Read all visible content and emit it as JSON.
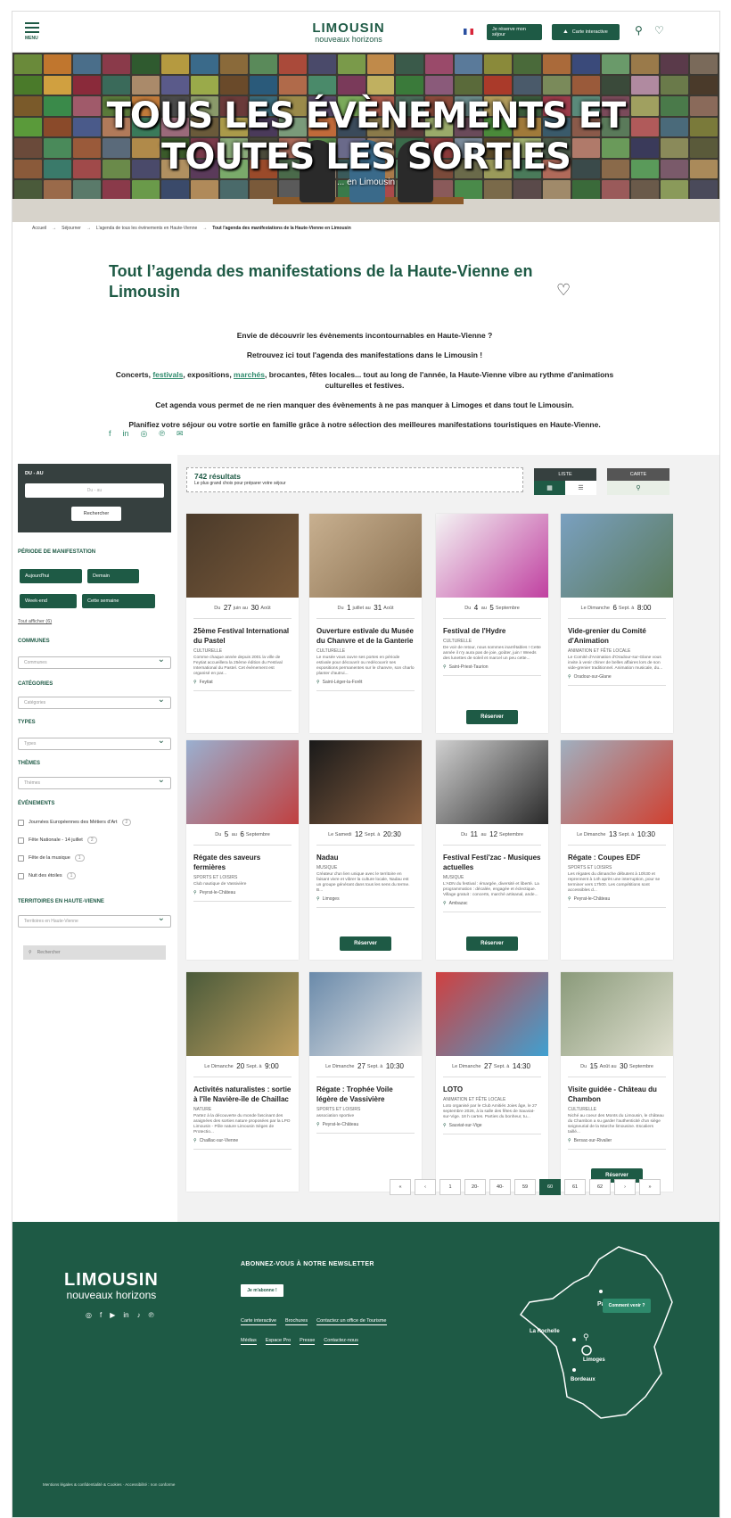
{
  "header": {
    "menu_label": "MENU",
    "logo_top": "LIMOUSIN",
    "logo_bottom": "nouveaux horizons",
    "reserve_label": "Je réserve mon séjour",
    "map_label": "Carte interactive"
  },
  "hero": {
    "title": "TOUS LES ÉVÈNEMENTS ET TOUTES LES SORTIES",
    "subtitle": "... en Limousin"
  },
  "breadcrumb": [
    "Accueil",
    "Séjourner",
    "L'agenda de tous les événements en Haute-Vienne",
    "Tout l'agenda des manifestations de la Haute-Vienne en Limousin"
  ],
  "page": {
    "title": "Tout l’agenda des manifestations de la Haute-Vienne en Limousin",
    "p1": "Envie de découvrir les évènements incontournables en Haute-Vienne ?",
    "p2": "Retrouvez ici tout l'agenda des manifestations dans le Limousin !",
    "p3_a": "Concerts, ",
    "p3_link1": "festivals",
    "p3_b": ", expositions, ",
    "p3_link2": "marchés",
    "p3_c": ", brocantes, fêtes locales... tout au long de l'année, la Haute-Vienne vibre au rythme d'animations culturelles et festives.",
    "p4": "Cet agenda vous permet de ne rien manquer des évènements à ne pas manquer à Limoges et dans tout le Limousin.",
    "p5": "Planifiez votre séjour ou votre sortie en famille grâce à notre sélection des meilleures manifestations touristiques en Haute-Vienne."
  },
  "sidebar": {
    "date_label": "DU - AU",
    "date_placeholder": "Du - au",
    "search_btn": "Rechercher",
    "period_title": "PÉRIODE DE MANIFESTATION",
    "periods": [
      "Aujourd'hui",
      "Demain",
      "Week-end",
      "Cette semaine"
    ],
    "show_all": "Tout afficher (6)",
    "communes_title": "COMMUNES",
    "communes_ph": "Communes",
    "categories_title": "CATÉGORIES",
    "categories_ph": "Catégories",
    "types_title": "TYPES",
    "types_ph": "Types",
    "themes_title": "THÈMES",
    "themes_ph": "Thèmes",
    "events_title": "ÉVÉNEMENTS",
    "events": [
      {
        "label": "Journées Européennes des Métiers d'Art",
        "count": "2"
      },
      {
        "label": "Fête Nationale - 14 juillet",
        "count": "2"
      },
      {
        "label": "Fête de la musique",
        "count": "1"
      },
      {
        "label": "Nuit des étoiles",
        "count": "1"
      }
    ],
    "terr_title": "TERRITOIRES EN HAUTE-VIENNE",
    "terr_ph": "Territoires en Haute-Vienne",
    "kw_ph": "Rechercher"
  },
  "results": {
    "count": "742 résultats",
    "sub": "Le plus grand choix pour préparer votre séjour",
    "list": "LISTE",
    "map": "CARTE"
  },
  "cards": [
    {
      "date_pre": "Du",
      "d1": "27",
      "m1": "juin",
      "mid": "au",
      "d2": "30",
      "m2": "Août",
      "title": "25ème Festival International du Pastel",
      "cat": "CULTURELLE",
      "desc": "Comme chaque année depuis 2001 la ville de Feytiat accueillera la 25ème édition du Festival International du Pastel. Cet évènement est organisé en par...",
      "loc": "Feytiat",
      "btn": ""
    },
    {
      "date_pre": "Du",
      "d1": "1",
      "m1": "juillet",
      "mid": "au",
      "d2": "31",
      "m2": "Août",
      "title": "Ouverture estivale du Musée du Chanvre et de la Ganterie",
      "cat": "CULTURELLE",
      "desc": "Le musée vous ouvre ses portes en période estivale pour découvrir ou redécouvrir ses expositions permanentes sur le chanvre, son charlo planter d'autrui...",
      "loc": "Saint-Léger-la-Forêt",
      "btn": ""
    },
    {
      "date_pre": "Du",
      "d1": "4",
      "m1": "",
      "mid": "au",
      "d2": "5",
      "m2": "Septembre",
      "title": "Festival de l'Hydre",
      "cat": "CULTURELLE",
      "desc": "De voir de retour, nous sommes inarrêtables ! Cette année il n'y aura pas de joie, goûter, juin ! Weeds des lunettes de soleil et marcel un peu cette...",
      "loc": "Saint-Priest-Taurion",
      "btn": "Réserver"
    },
    {
      "date_pre": "Le Dimanche",
      "d1": "6",
      "m1": "Sept.",
      "mid": "à",
      "d2": "8:00",
      "m2": "",
      "title": "Vide-grenier du Comité d'Animation",
      "cat": "ANIMATION ET FÊTE LOCALE",
      "desc": "Le Comité d'Animation d'Oradour-sur-Glane vous invite à venir chiner de belles affaires lors de son vide-grenier traditionnel. Animation musicale, du...",
      "loc": "Oradour-sur-Glane",
      "btn": ""
    },
    {
      "date_pre": "Du",
      "d1": "5",
      "m1": "",
      "mid": "au",
      "d2": "6",
      "m2": "Septembre",
      "title": "Régate des saveurs fermières",
      "cat": "SPORTS ET LOISIRS",
      "desc": "Club nautique de Vassivière",
      "loc": "Peyrat-le-Château",
      "btn": ""
    },
    {
      "date_pre": "Le Samedi",
      "d1": "12",
      "m1": "Sept.",
      "mid": "à",
      "d2": "20:30",
      "m2": "",
      "title": "Nadau",
      "cat": "MUSIQUE",
      "desc": "Créateur d'un lien unique avec le territoire en faisant vivre et vibrer la culture locale, Nadau est un groupe générant dans tous les sens du terme. B...",
      "loc": "Limoges",
      "btn": "Réserver"
    },
    {
      "date_pre": "Du",
      "d1": "11",
      "m1": "",
      "mid": "au",
      "d2": "12",
      "m2": "Septembre",
      "title": "Festival Festi'zac - Musiques actuelles",
      "cat": "MUSIQUE",
      "desc": "L'ADN du festival : émargée, diversité et liberté. La programmation : décalée, engagée et éclectique. Village gratuit : concerts, marché artisanal, ande...",
      "loc": "Ambazac",
      "btn": "Réserver"
    },
    {
      "date_pre": "Le Dimanche",
      "d1": "13",
      "m1": "Sept.",
      "mid": "à",
      "d2": "10:30",
      "m2": "",
      "title": "Régate : Coupes EDF",
      "cat": "SPORTS ET LOISIRS",
      "desc": "Les régates du dimanche débutent à 10h30 et reprennent à 14h après une interruption, pour se terminer vers 17h00. Les compétitions sont accessibles d...",
      "loc": "Peyrat-le-Château",
      "btn": ""
    },
    {
      "date_pre": "Le Dimanche",
      "d1": "20",
      "m1": "Sept.",
      "mid": "à",
      "d2": "9:00",
      "m2": "",
      "title": "Activités naturalistes : sortie à l'île Navière-île de Chaillac",
      "cat": "NATURE",
      "desc": "Partez à la découverte du monde fascinant des araignées des sorties nature proposées par la LPO Limousin - Pôle nature Limousin Sèges de Protectio...",
      "loc": "Chaillac-sur-Vienne",
      "btn": ""
    },
    {
      "date_pre": "Le Dimanche",
      "d1": "27",
      "m1": "Sept.",
      "mid": "à",
      "d2": "10:30",
      "m2": "",
      "title": "Régate : Trophée Voile légère de Vassivière",
      "cat": "SPORTS ET LOISIRS",
      "desc": "association sportive",
      "loc": "Peyrat-le-Château",
      "btn": ""
    },
    {
      "date_pre": "Le Dimanche",
      "d1": "27",
      "m1": "Sept.",
      "mid": "à",
      "d2": "14:30",
      "m2": "",
      "title": "LOTO",
      "cat": "ANIMATION ET FÊTE LOCALE",
      "desc": "Loto organisé par le Club Amitiés Joies âge, le 27 septembre 2026, à la salle des fêtes de Sauviat-sur-Vige. 18 h cartes. Parties du bonheur, tu...",
      "loc": "Sauviat-sur-Vige",
      "btn": ""
    },
    {
      "date_pre": "Du",
      "d1": "15",
      "m1": "Août",
      "mid": "au",
      "d2": "30",
      "m2": "Septembre",
      "title": "Visite guidée - Château du Chambon",
      "cat": "CULTURELLE",
      "desc": "Niché au coeur des Monts du Limousin, le château du Chambon a su garder l'authenticité d'un siège seigneurial de la Marche limousine. Escaliers taillé...",
      "loc": "Bersac-sur-Rivalier",
      "btn": "Réserver"
    }
  ],
  "pager": [
    "«",
    "‹",
    "1",
    "20-",
    "40-",
    "59",
    "60",
    "61",
    "62",
    "›",
    "»"
  ],
  "footer": {
    "logo_top": "LIMOUSIN",
    "logo_bottom": "nouveaux horizons",
    "newsletter": "ABONNEZ-VOUS À NOTRE NEWSLETTER",
    "subscribe": "Je m'abonne !",
    "links1": [
      "Carte interactive",
      "Brochures",
      "Contactez un office de Tourisme"
    ],
    "links2": [
      "Médias",
      "Espace Pro",
      "Presse",
      "Contactez-nous"
    ],
    "map_paris": "Paris",
    "map_larochelle": "La Rochelle",
    "map_limoges": "Limoges",
    "map_bordeaux": "Bordeaux",
    "map_btn": "Comment venir ?",
    "legal": "Mentions légales & confidentialité & Cookies · Accessibilité : non conforme"
  },
  "colors": {
    "brand": "#1e5a45",
    "accent": "#2e8a6c"
  }
}
